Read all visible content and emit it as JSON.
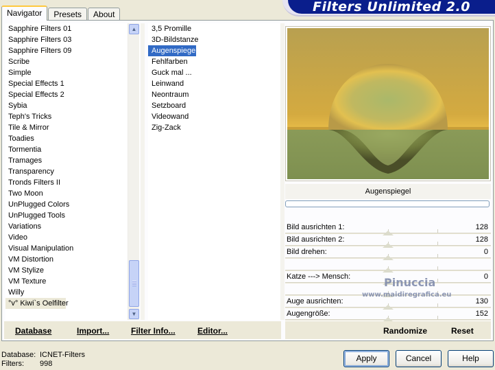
{
  "tabs": [
    {
      "label": "Navigator",
      "active": true
    },
    {
      "label": "Presets",
      "active": false
    },
    {
      "label": "About",
      "active": false
    }
  ],
  "banner_title": "Filters Unlimited 2.0",
  "categories": [
    "Sapphire Filters 01",
    "Sapphire Filters 03",
    "Sapphire Filters 09",
    "Scribe",
    "Simple",
    "Special Effects 1",
    "Special Effects 2",
    "Sybia",
    "Teph's Tricks",
    "Tile & Mirror",
    "Toadies",
    "Tormentia",
    "Tramages",
    "Transparency",
    "Tronds Filters II",
    "Two Moon",
    "UnPlugged Colors",
    "UnPlugged Tools",
    "Variations",
    "Video",
    "Visual Manipulation",
    "VM Distortion",
    "VM Stylize",
    "VM Texture",
    "Willy",
    "°v° Kiwi`s Oelfilter"
  ],
  "selected_category_index": 25,
  "filters": [
    "3,5 Promille",
    "3D-Bildstanze",
    "Augenspiegel",
    "Fehlfarben",
    "Guck mal ...",
    "Leinwand",
    "Neontraum",
    "Setzboard",
    "Videowand",
    "Zig-Zack"
  ],
  "selected_filter_index": 2,
  "current_filter_name": "Augenspiegel",
  "progress": 0,
  "parameters": [
    {
      "label": "Bild ausrichten 1:",
      "value": "128"
    },
    {
      "label": "Bild ausrichten 2:",
      "value": "128"
    },
    {
      "label": "Bild drehen:",
      "value": "0"
    },
    {
      "label": "",
      "value": ""
    },
    {
      "label": "Katze ---> Mensch:",
      "value": "0"
    },
    {
      "label": "",
      "value": ""
    },
    {
      "label": "Auge ausrichten:",
      "value": "130"
    },
    {
      "label": "Augengröße:",
      "value": "152"
    }
  ],
  "watermark": {
    "name": "Pinuccia",
    "url": "www.maidiregrafica.eu"
  },
  "toolbar": {
    "database": "Database",
    "import": "Import...",
    "filter_info": "Filter Info...",
    "editor": "Editor...",
    "randomize": "Randomize",
    "reset": "Reset"
  },
  "status": {
    "database_label": "Database:",
    "database_value": "ICNET-Filters",
    "filters_label": "Filters:",
    "filters_value": "998"
  },
  "buttons": {
    "apply": "Apply",
    "cancel": "Cancel",
    "help": "Help"
  },
  "colors": {
    "selection": "#316ac5",
    "banner": "#0a1e8c",
    "scroll_accent": "#c6d3f7"
  }
}
